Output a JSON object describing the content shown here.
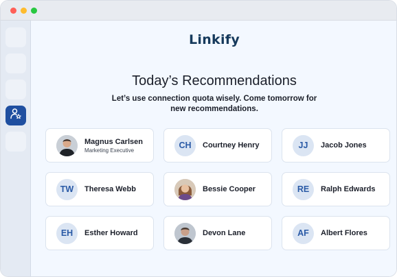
{
  "window": {
    "controls": [
      "close",
      "minimize",
      "maximize"
    ]
  },
  "sidebar": {
    "items": [
      {
        "icon": "blank",
        "active": false
      },
      {
        "icon": "blank",
        "active": false
      },
      {
        "icon": "blank",
        "active": false
      },
      {
        "icon": "user-star-icon",
        "active": true
      },
      {
        "icon": "blank",
        "active": false
      }
    ],
    "active_color": "#1f4fa0"
  },
  "header": {
    "logo": "Linkify"
  },
  "main": {
    "title": "Today’s Recommendations",
    "subtitle": "Let’s use connection quota wisely. Come tomorrow for new recommendations."
  },
  "recommendations": [
    {
      "name": "Magnus Carlsen",
      "role": "Marketing Executive",
      "avatar": "photo"
    },
    {
      "name": "Courtney Henry",
      "initials": "CH",
      "avatar": "initials"
    },
    {
      "name": "Jacob Jones",
      "initials": "JJ",
      "avatar": "initials"
    },
    {
      "name": "Theresa Webb",
      "initials": "TW",
      "avatar": "initials"
    },
    {
      "name": "Bessie Cooper",
      "avatar": "photo"
    },
    {
      "name": "Ralph Edwards",
      "initials": "RE",
      "avatar": "initials"
    },
    {
      "name": "Esther Howard",
      "initials": "EH",
      "avatar": "initials"
    },
    {
      "name": "Devon Lane",
      "avatar": "photo"
    },
    {
      "name": "Albert Flores",
      "initials": "AF",
      "avatar": "initials"
    }
  ],
  "colors": {
    "brand": "#163a5c",
    "initials_bg": "#dbe5f3",
    "initials_text": "#2a5aa6",
    "page_bg": "#f3f8ff"
  }
}
